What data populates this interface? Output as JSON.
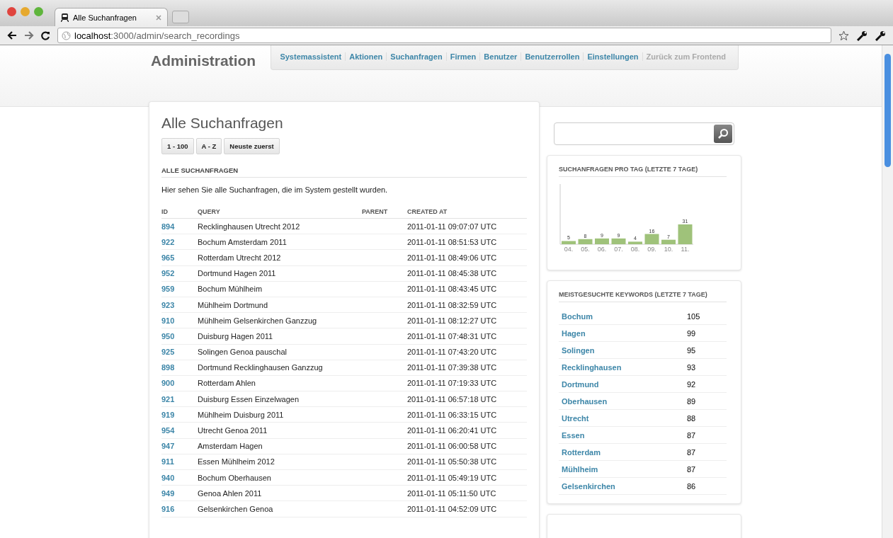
{
  "browser": {
    "tab_title": "Alle Suchanfragen",
    "url_host": "localhost",
    "url_path": ":3000/admin/search_recordings"
  },
  "header": {
    "title": "Administration",
    "nav": [
      {
        "label": "Systemassistent",
        "kind": "admin"
      },
      {
        "label": "Aktionen",
        "kind": "admin"
      },
      {
        "label": "Suchanfragen",
        "kind": "admin"
      },
      {
        "label": "Firmen",
        "kind": "admin"
      },
      {
        "label": "Benutzer",
        "kind": "admin"
      },
      {
        "label": "Benutzerrollen",
        "kind": "admin"
      },
      {
        "label": "Einstellungen",
        "kind": "admin"
      },
      {
        "label": "Zurück zum Frontend",
        "kind": "frontend"
      }
    ]
  },
  "main": {
    "title": "Alle Suchanfragen",
    "sort_buttons": [
      "1 - 100",
      "A - Z",
      "Neuste zuerst"
    ],
    "section_title": "ALLE SUCHANFRAGEN",
    "description": "Hier sehen Sie alle Suchanfragen, die im System gestellt wurden.",
    "table": {
      "columns": [
        "ID",
        "QUERY",
        "PARENT",
        "CREATED AT"
      ],
      "rows": [
        [
          "894",
          "Recklinghausen Utrecht 2012",
          "2011-01-11 09:07:07 UTC"
        ],
        [
          "922",
          "Bochum Amsterdam 2011",
          "2011-01-11 08:51:53 UTC"
        ],
        [
          "965",
          "Rotterdam Utrecht 2012",
          "2011-01-11 08:49:06 UTC"
        ],
        [
          "952",
          "Dortmund Hagen 2011",
          "2011-01-11 08:45:38 UTC"
        ],
        [
          "959",
          "Bochum Mühlheim",
          "2011-01-11 08:43:45 UTC"
        ],
        [
          "923",
          "Mühlheim Dortmund",
          "2011-01-11 08:32:59 UTC"
        ],
        [
          "910",
          "Mühlheim Gelsenkirchen Ganzzug",
          "2011-01-11 08:12:27 UTC"
        ],
        [
          "950",
          "Duisburg Hagen 2011",
          "2011-01-11 07:48:31 UTC"
        ],
        [
          "925",
          "Solingen Genoa pauschal",
          "2011-01-11 07:43:20 UTC"
        ],
        [
          "898",
          "Dortmund Recklinghausen Ganzzug",
          "2011-01-11 07:39:38 UTC"
        ],
        [
          "900",
          "Rotterdam Ahlen",
          "2011-01-11 07:19:33 UTC"
        ],
        [
          "921",
          "Duisburg Essen Einzelwagen",
          "2011-01-11 06:57:18 UTC"
        ],
        [
          "919",
          "Mühlheim Duisburg 2011",
          "2011-01-11 06:33:15 UTC"
        ],
        [
          "954",
          "Utrecht Genoa 2011",
          "2011-01-11 06:20:41 UTC"
        ],
        [
          "947",
          "Amsterdam Hagen",
          "2011-01-11 06:00:58 UTC"
        ],
        [
          "911",
          "Essen Mühlheim 2012",
          "2011-01-11 05:50:38 UTC"
        ],
        [
          "940",
          "Bochum Oberhausen",
          "2011-01-11 05:49:19 UTC"
        ],
        [
          "949",
          "Genoa Ahlen 2011",
          "2011-01-11 05:11:50 UTC"
        ],
        [
          "916",
          "Gelsenkirchen Genoa",
          "2011-01-11 04:52:09 UTC"
        ]
      ]
    }
  },
  "sidebar": {
    "per_day": {
      "title": "SUCHANFRAGEN PRO TAG (LETZTE 7 TAGE)",
      "chart_data": {
        "type": "bar",
        "categories": [
          "04.",
          "05.",
          "06.",
          "07.",
          "08.",
          "09.",
          "10.",
          "11."
        ],
        "values": [
          5,
          8,
          9,
          9,
          4,
          16,
          7,
          31
        ],
        "data_labels": true
      }
    },
    "keywords": {
      "title": "MEISTGESUCHTE KEYWORDS (LETZTE 7 TAGE)",
      "rows": [
        [
          "Bochum",
          "105"
        ],
        [
          "Hagen",
          "99"
        ],
        [
          "Solingen",
          "95"
        ],
        [
          "Recklinghausen",
          "93"
        ],
        [
          "Dortmund",
          "92"
        ],
        [
          "Oberhausen",
          "89"
        ],
        [
          "Utrecht",
          "88"
        ],
        [
          "Essen",
          "87"
        ],
        [
          "Rotterdam",
          "87"
        ],
        [
          "Mühlheim",
          "87"
        ],
        [
          "Gelsenkirchen",
          "86"
        ]
      ]
    }
  }
}
